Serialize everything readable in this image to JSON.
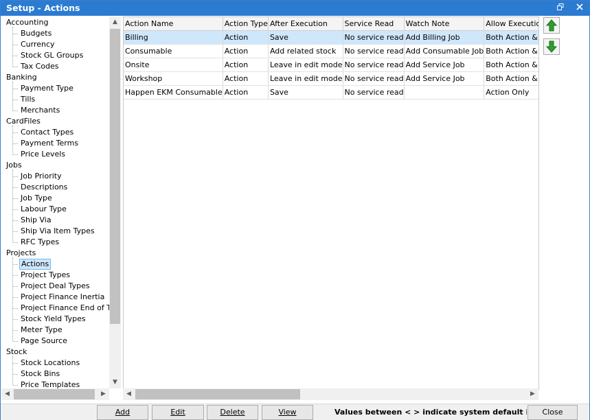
{
  "window": {
    "title": "Setup - Actions",
    "restore_icon": "restore-icon",
    "close_icon": "close-icon"
  },
  "tree": {
    "nodes": [
      {
        "type": "cat",
        "label": "Accounting"
      },
      {
        "type": "child",
        "label": "Budgets"
      },
      {
        "type": "child",
        "label": "Currency"
      },
      {
        "type": "child",
        "label": "Stock GL Groups"
      },
      {
        "type": "child",
        "label": "Tax Codes"
      },
      {
        "type": "cat",
        "label": "Banking"
      },
      {
        "type": "child",
        "label": "Payment Type"
      },
      {
        "type": "child",
        "label": "Tills"
      },
      {
        "type": "child",
        "label": "Merchants"
      },
      {
        "type": "cat",
        "label": "CardFiles"
      },
      {
        "type": "child",
        "label": "Contact Types"
      },
      {
        "type": "child",
        "label": "Payment Terms"
      },
      {
        "type": "child",
        "label": "Price Levels"
      },
      {
        "type": "cat",
        "label": "Jobs"
      },
      {
        "type": "child",
        "label": "Job Priority"
      },
      {
        "type": "child",
        "label": "Descriptions"
      },
      {
        "type": "child",
        "label": "Job Type"
      },
      {
        "type": "child",
        "label": "Labour Type"
      },
      {
        "type": "child",
        "label": "Ship Via"
      },
      {
        "type": "child",
        "label": "Ship Via Item Types"
      },
      {
        "type": "child",
        "label": "RFC Types"
      },
      {
        "type": "cat",
        "label": "Projects"
      },
      {
        "type": "child",
        "label": "Actions",
        "selected": true
      },
      {
        "type": "child",
        "label": "Project Types"
      },
      {
        "type": "child",
        "label": "Project Deal Types"
      },
      {
        "type": "child",
        "label": "Project Finance Inertia"
      },
      {
        "type": "child",
        "label": "Project Finance End of Term"
      },
      {
        "type": "child",
        "label": "Stock Yield Types"
      },
      {
        "type": "child",
        "label": "Meter Type"
      },
      {
        "type": "child",
        "label": "Page Source"
      },
      {
        "type": "cat",
        "label": "Stock"
      },
      {
        "type": "child",
        "label": "Stock Locations"
      },
      {
        "type": "child",
        "label": "Stock Bins"
      },
      {
        "type": "child",
        "label": "Price Templates"
      }
    ]
  },
  "grid": {
    "columns": [
      "Action Name",
      "Action Type",
      "After Execution",
      "Service Read",
      "Watch Note",
      "Allow Execution of"
    ],
    "rows": [
      [
        "Billing",
        "Action",
        "Save",
        "No service read",
        "Add Billing Job",
        "Both Action & Template/Ch"
      ],
      [
        "Consumable",
        "Action",
        "Add related stock",
        "No service read",
        "Add Consumable Job",
        "Both Action & Template/Ch"
      ],
      [
        "Onsite",
        "Action",
        "Leave in edit mode",
        "No service read",
        "Add Service Job",
        "Both Action & Template/Ch"
      ],
      [
        "Workshop",
        "Action",
        "Leave in edit mode",
        "No service read",
        "Add Service Job",
        "Both Action & Template/Ch"
      ],
      [
        "Happen EKM Consumable",
        "Action",
        "Save",
        "No service read",
        "",
        "Action Only"
      ]
    ],
    "selected_row": 0
  },
  "side_buttons": {
    "up_icon": "arrow-up-icon",
    "down_icon": "arrow-down-icon",
    "color": "#2e9e2e"
  },
  "footer": {
    "add": "Add",
    "edit": "Edit",
    "delete": "Delete",
    "view": "View",
    "note": "Values between < > indicate system default is used",
    "close": "Close"
  },
  "colors": {
    "titlebar": "#2b7bd1",
    "selection": "#cfe7fb"
  }
}
